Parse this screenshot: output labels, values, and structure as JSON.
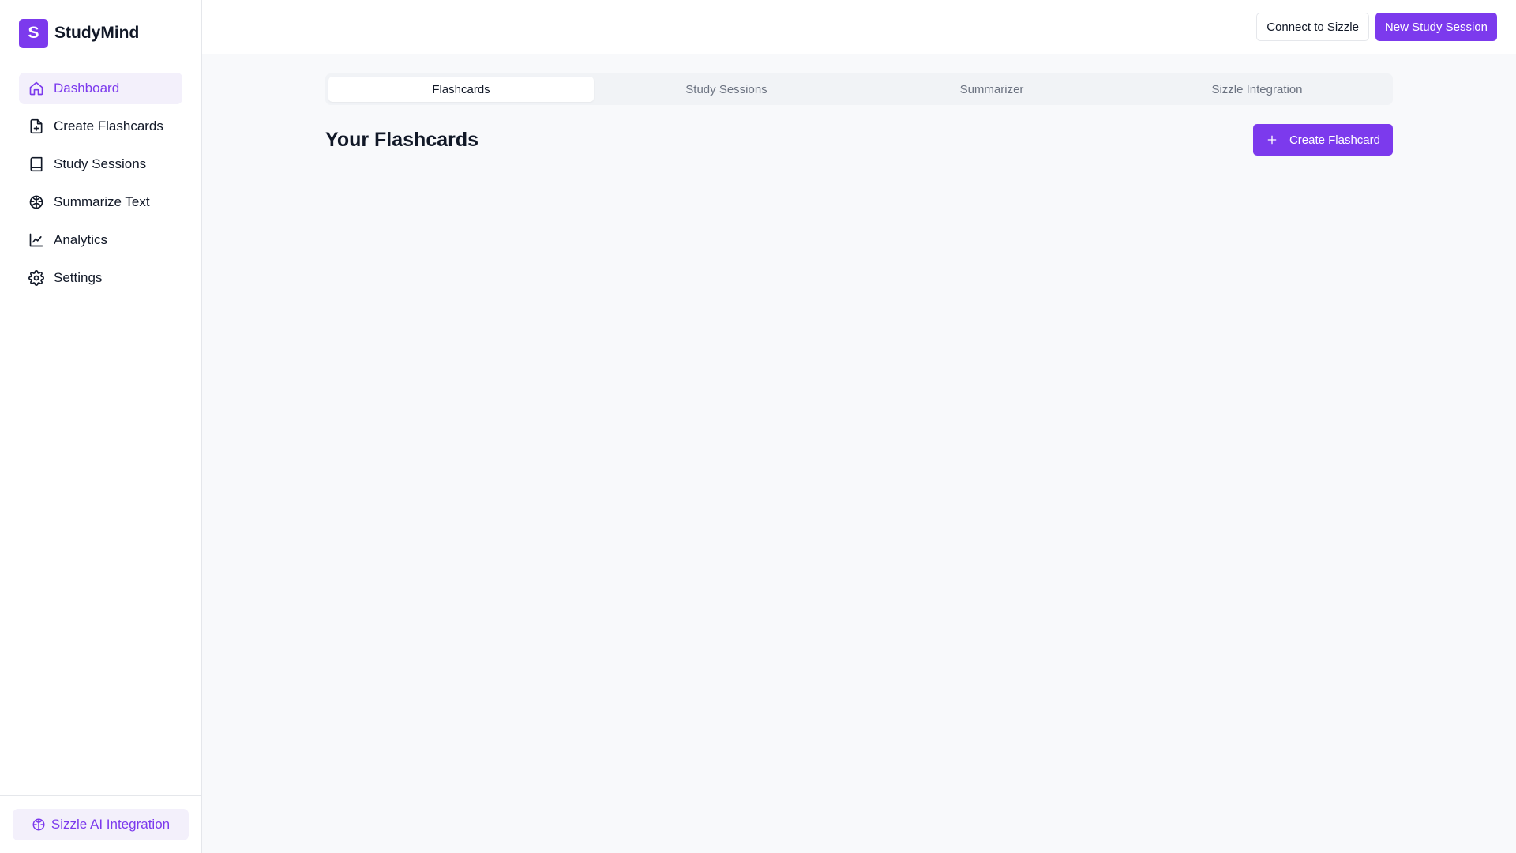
{
  "brand": {
    "logo_letter": "S",
    "name": "StudyMind",
    "accent": "#7c3aed"
  },
  "sidebar": {
    "items": [
      {
        "label": "Dashboard",
        "icon": "home-icon",
        "active": true
      },
      {
        "label": "Create Flashcards",
        "icon": "file-plus-icon"
      },
      {
        "label": "Study Sessions",
        "icon": "book-icon"
      },
      {
        "label": "Summarize Text",
        "icon": "brain-icon"
      },
      {
        "label": "Analytics",
        "icon": "line-chart-icon"
      },
      {
        "label": "Settings",
        "icon": "gear-icon"
      }
    ],
    "footer_button": {
      "label": "Sizzle AI Integration",
      "icon": "brain-icon"
    }
  },
  "topbar": {
    "connect_label": "Connect to Sizzle",
    "new_session_label": "New Study Session"
  },
  "tabs": [
    {
      "label": "Flashcards",
      "active": true
    },
    {
      "label": "Study Sessions"
    },
    {
      "label": "Summarizer"
    },
    {
      "label": "Sizzle Integration"
    }
  ],
  "main": {
    "title": "Your Flashcards",
    "create_button": {
      "label": "Create Flashcard",
      "icon": "plus-icon"
    }
  }
}
